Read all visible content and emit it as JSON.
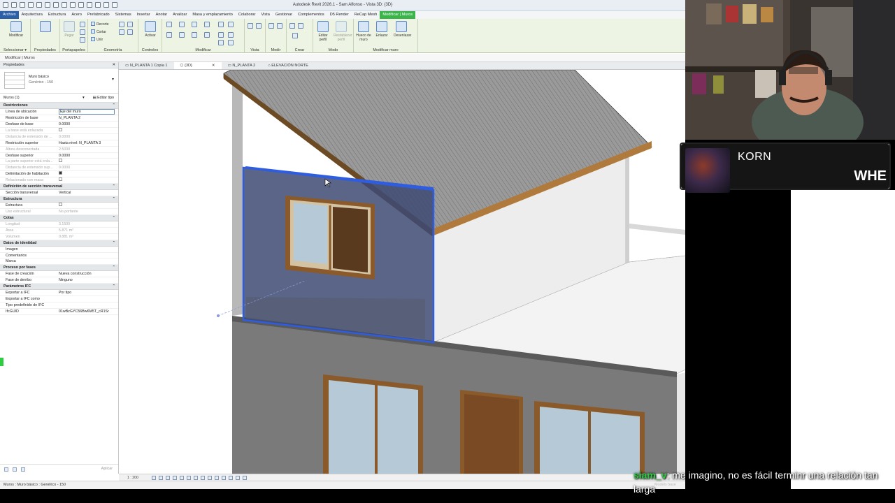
{
  "app": {
    "title": "Autodesk Revit 2026.1 - Sam Alfonso - Vista 3D: {3D}",
    "tabs": [
      "Archivo",
      "Arquitectura",
      "Estructura",
      "Acero",
      "Prefabricado",
      "Sistemas",
      "Insertar",
      "Anotar",
      "Analizar",
      "Masa y emplazamiento",
      "Colaborar",
      "Vista",
      "Gestionar",
      "Complementos",
      "D5 Render",
      "ReCap Mesh",
      "Modificar | Muros"
    ],
    "context_breadcrumb": "Modificar | Muros"
  },
  "ribbon": {
    "panels": [
      "Seleccionar",
      "Propiedades",
      "Portapapeles",
      "Geometría",
      "Modificar",
      "Vista",
      "Medir",
      "Crear",
      "Modo",
      "Modificar muro"
    ],
    "buttons": {
      "modify": "Modificar",
      "paste": "Pegar",
      "cope": "Recorte",
      "cut": "Cortar",
      "join": "Unir",
      "activate": "Activar",
      "edit_profile": "Editar perfil",
      "reset_profile": "Restablecer perfil",
      "wall_opening": "Hueco de muro",
      "attach": "Enlazar",
      "detach": "Desenlazar"
    },
    "select_dropdown": "Seleccionar ▾"
  },
  "properties": {
    "title": "Propiedades",
    "type_family": "Muro básico",
    "type_name": "Genérico - 150",
    "instance_filter": "Muros (1)",
    "edit_type": "Editar tipo",
    "apply": "Aplicar",
    "groups": [
      {
        "name": "Restricciones",
        "rows": [
          {
            "k": "Línea de ubicación",
            "v": "Eje del muro",
            "box": true
          },
          {
            "k": "Restricción de base",
            "v": "N_PLANTA 2"
          },
          {
            "k": "Desfase de base",
            "v": "0.0000"
          },
          {
            "k": "La base está enlazada",
            "v": "",
            "check": false,
            "dim": true
          },
          {
            "k": "Distancia de extensión de ...",
            "v": "0.0000",
            "dim": true
          },
          {
            "k": "Restricción superior",
            "v": "Hasta nivel: N_PLANTA 3"
          },
          {
            "k": "Altura desconectada",
            "v": "2.5000",
            "dim": true
          },
          {
            "k": "Desfase superior",
            "v": "0.0000"
          },
          {
            "k": "La parte superior está enla...",
            "v": "",
            "check": false,
            "dim": true
          },
          {
            "k": "Distancia de extensión sup...",
            "v": "0.0000",
            "dim": true
          },
          {
            "k": "Delimitación de habitación",
            "v": "",
            "check": true
          },
          {
            "k": "Relacionado con masa",
            "v": "",
            "check": false,
            "dim": true
          }
        ]
      },
      {
        "name": "Definición de sección transversal",
        "rows": [
          {
            "k": "Sección transversal",
            "v": "Vertical"
          }
        ]
      },
      {
        "name": "Estructura",
        "rows": [
          {
            "k": "Estructura",
            "v": "",
            "check": false
          },
          {
            "k": "Uso estructural",
            "v": "No portante",
            "dim": true
          }
        ]
      },
      {
        "name": "Cotas",
        "rows": [
          {
            "k": "Longitud",
            "v": "3.1500",
            "dim": true
          },
          {
            "k": "Área",
            "v": "5.871 m²",
            "dim": true
          },
          {
            "k": "Volumen",
            "v": "0.881 m³",
            "dim": true
          }
        ]
      },
      {
        "name": "Datos de identidad",
        "rows": [
          {
            "k": "Imagen",
            "v": ""
          },
          {
            "k": "Comentarios",
            "v": ""
          },
          {
            "k": "Marca",
            "v": ""
          }
        ]
      },
      {
        "name": "Proceso por fases",
        "rows": [
          {
            "k": "Fase de creación",
            "v": "Nueva construcción"
          },
          {
            "k": "Fase de derribo",
            "v": "Ninguno"
          }
        ]
      },
      {
        "name": "Parámetros IFC",
        "rows": [
          {
            "k": "Exportar a IFC",
            "v": "Por tipo"
          },
          {
            "k": "Exportar a IFC como",
            "v": ""
          },
          {
            "k": "Tipo predefinido de IFC",
            "v": ""
          },
          {
            "k": "IfcGUID",
            "v": "01wBzGYC56Bw6M5T_cR1Sr"
          }
        ]
      }
    ]
  },
  "view_tabs": [
    "N_PLANTA 1 Copia 1",
    "{3D}",
    "N_PLANTA 2",
    "ELEVACIÓN NORTE"
  ],
  "view_controls": {
    "scale": "1 : 200"
  },
  "statusbar": {
    "text": "Muros : Muro básico : Genérico - 150",
    "model": "Modelo base"
  },
  "now_playing": {
    "artist": "KORN",
    "song": "WHE"
  },
  "chat": {
    "user": "siam_v",
    "message": "me imagino, no es fácil terminr una relación tan larga"
  },
  "colors": {
    "selection": "#2f5de0",
    "ribbon_context": "#3bb54a",
    "wood": "#8b5a2b"
  }
}
